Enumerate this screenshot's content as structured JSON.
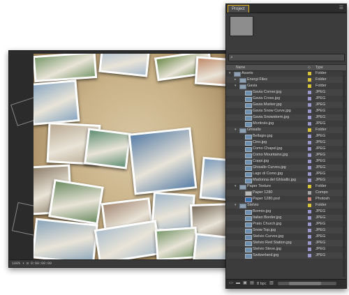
{
  "viewer": {
    "status_text": "100%  ▾  ⊡  0:00:00:00",
    "photos": [
      {
        "color": "#7a9a6c",
        "rot": -4
      },
      {
        "color": "#a9bccf",
        "rot": 6
      },
      {
        "color": "#6f8c4e",
        "rot": -8
      },
      {
        "color": "#c08b6a",
        "rot": 4
      },
      {
        "color": "#8aa8c3",
        "rot": -5
      },
      {
        "color": "#b9a992",
        "rot": 3
      },
      {
        "color": "#5f8f74",
        "rot": 7
      },
      {
        "color": "#5a7fa8",
        "rot": -6
      },
      {
        "color": "#7c9bbd",
        "rot": 5
      },
      {
        "color": "#8a7a66",
        "rot": -3
      },
      {
        "color": "#6b8c63",
        "rot": 9
      },
      {
        "color": "#a58a76",
        "rot": -7
      },
      {
        "color": "#9fb5c9",
        "rot": 4
      },
      {
        "color": "#786a5a",
        "rot": -2
      },
      {
        "color": "#89a4bb",
        "rot": 6
      },
      {
        "color": "#aebfcd",
        "rot": -9
      }
    ]
  },
  "panel": {
    "tab_label": "Project",
    "menu_icon": "panel-menu-icon",
    "search_icon": "search-icon",
    "columns": {
      "name": "Name",
      "label": "◇",
      "type": "Type"
    },
    "bottom": {
      "bpc_label": "8 bpc"
    },
    "colors": {
      "folder_yellow": "#d8c33a",
      "jpeg_lavender": "#9a97cf",
      "comp_gray": "#a8a8a8",
      "psd_salmon": "#c98878",
      "accent": "#e3b324"
    },
    "items": [
      {
        "name": "Assets",
        "type": "Folder",
        "indent": 0,
        "kind": "folder",
        "swatch": "folder_yellow",
        "twirl": "▾"
      },
      {
        "name": "Energi Files",
        "type": "Folder",
        "indent": 1,
        "kind": "folder",
        "swatch": "folder_yellow",
        "twirl": "▸"
      },
      {
        "name": "Gavia",
        "type": "Folder",
        "indent": 1,
        "kind": "folder",
        "swatch": "folder_yellow",
        "twirl": "▾"
      },
      {
        "name": "Gavia Corner.jpg",
        "type": "JPEG",
        "indent": 2,
        "kind": "file",
        "swatch": "jpeg_lavender",
        "twirl": ""
      },
      {
        "name": "Gavia Cross.jpg",
        "type": "JPEG",
        "indent": 2,
        "kind": "file",
        "swatch": "jpeg_lavender",
        "twirl": ""
      },
      {
        "name": "Gavia Marker.jpg",
        "type": "JPEG",
        "indent": 2,
        "kind": "file",
        "swatch": "jpeg_lavender",
        "twirl": ""
      },
      {
        "name": "Gavia Snow Curve.jpg",
        "type": "JPEG",
        "indent": 2,
        "kind": "file",
        "swatch": "jpeg_lavender",
        "twirl": ""
      },
      {
        "name": "Gavia Snowstorm.jpg",
        "type": "JPEG",
        "indent": 2,
        "kind": "file",
        "swatch": "jpeg_lavender",
        "twirl": ""
      },
      {
        "name": "Mortirolo.jpg",
        "type": "JPEG",
        "indent": 2,
        "kind": "file",
        "swatch": "jpeg_lavender",
        "twirl": ""
      },
      {
        "name": "Ghisallo",
        "type": "Folder",
        "indent": 1,
        "kind": "folder",
        "swatch": "folder_yellow",
        "twirl": "▾"
      },
      {
        "name": "Bellagio.jpg",
        "type": "JPEG",
        "indent": 2,
        "kind": "file",
        "swatch": "jpeg_lavender",
        "twirl": ""
      },
      {
        "name": "Cino.jpg",
        "type": "JPEG",
        "indent": 2,
        "kind": "file",
        "swatch": "jpeg_lavender",
        "twirl": ""
      },
      {
        "name": "Como Chapel.jpg",
        "type": "JPEG",
        "indent": 2,
        "kind": "file",
        "swatch": "jpeg_lavender",
        "twirl": ""
      },
      {
        "name": "Como Mountains.jpg",
        "type": "JPEG",
        "indent": 2,
        "kind": "file",
        "swatch": "jpeg_lavender",
        "twirl": ""
      },
      {
        "name": "Coppi.jpg",
        "type": "JPEG",
        "indent": 2,
        "kind": "file",
        "swatch": "jpeg_lavender",
        "twirl": ""
      },
      {
        "name": "Ghisallo Curves.jpg",
        "type": "JPEG",
        "indent": 2,
        "kind": "file",
        "swatch": "jpeg_lavender",
        "twirl": ""
      },
      {
        "name": "Lago di Como.jpg",
        "type": "JPEG",
        "indent": 2,
        "kind": "file",
        "swatch": "jpeg_lavender",
        "twirl": ""
      },
      {
        "name": "Madonna del Ghisallo.jpg",
        "type": "JPEG",
        "indent": 2,
        "kind": "file",
        "swatch": "jpeg_lavender",
        "twirl": ""
      },
      {
        "name": "Paper Texture",
        "type": "Folder",
        "indent": 1,
        "kind": "folder",
        "swatch": "folder_yellow",
        "twirl": "▾"
      },
      {
        "name": "Paper 1280",
        "type": "Compo",
        "indent": 2,
        "kind": "comp",
        "swatch": "comp_gray",
        "twirl": ""
      },
      {
        "name": "Paper 1280.psd",
        "type": "Photosh",
        "indent": 2,
        "kind": "psd",
        "swatch": "psd_salmon",
        "twirl": ""
      },
      {
        "name": "Stelvio",
        "type": "Folder",
        "indent": 1,
        "kind": "folder",
        "swatch": "folder_yellow",
        "twirl": "▾"
      },
      {
        "name": "Bormio.jpg",
        "type": "JPEG",
        "indent": 2,
        "kind": "file",
        "swatch": "jpeg_lavender",
        "twirl": ""
      },
      {
        "name": "Italian Border.jpg",
        "type": "JPEG",
        "indent": 2,
        "kind": "file",
        "swatch": "jpeg_lavender",
        "twirl": ""
      },
      {
        "name": "Prato Church.jpg",
        "type": "JPEG",
        "indent": 2,
        "kind": "file",
        "swatch": "jpeg_lavender",
        "twirl": ""
      },
      {
        "name": "Snow Top.jpg",
        "type": "JPEG",
        "indent": 2,
        "kind": "file",
        "swatch": "jpeg_lavender",
        "twirl": ""
      },
      {
        "name": "Stelvio Curves.jpg",
        "type": "JPEG",
        "indent": 2,
        "kind": "file",
        "swatch": "jpeg_lavender",
        "twirl": ""
      },
      {
        "name": "Stelvio Red Station.jpg",
        "type": "JPEG",
        "indent": 2,
        "kind": "file",
        "swatch": "jpeg_lavender",
        "twirl": ""
      },
      {
        "name": "Stelvio Steve.jpg",
        "type": "JPEG",
        "indent": 2,
        "kind": "file",
        "swatch": "jpeg_lavender",
        "twirl": ""
      },
      {
        "name": "Switzerland.jpg",
        "type": "JPEG",
        "indent": 2,
        "kind": "file",
        "swatch": "jpeg_lavender",
        "twirl": ""
      }
    ]
  }
}
